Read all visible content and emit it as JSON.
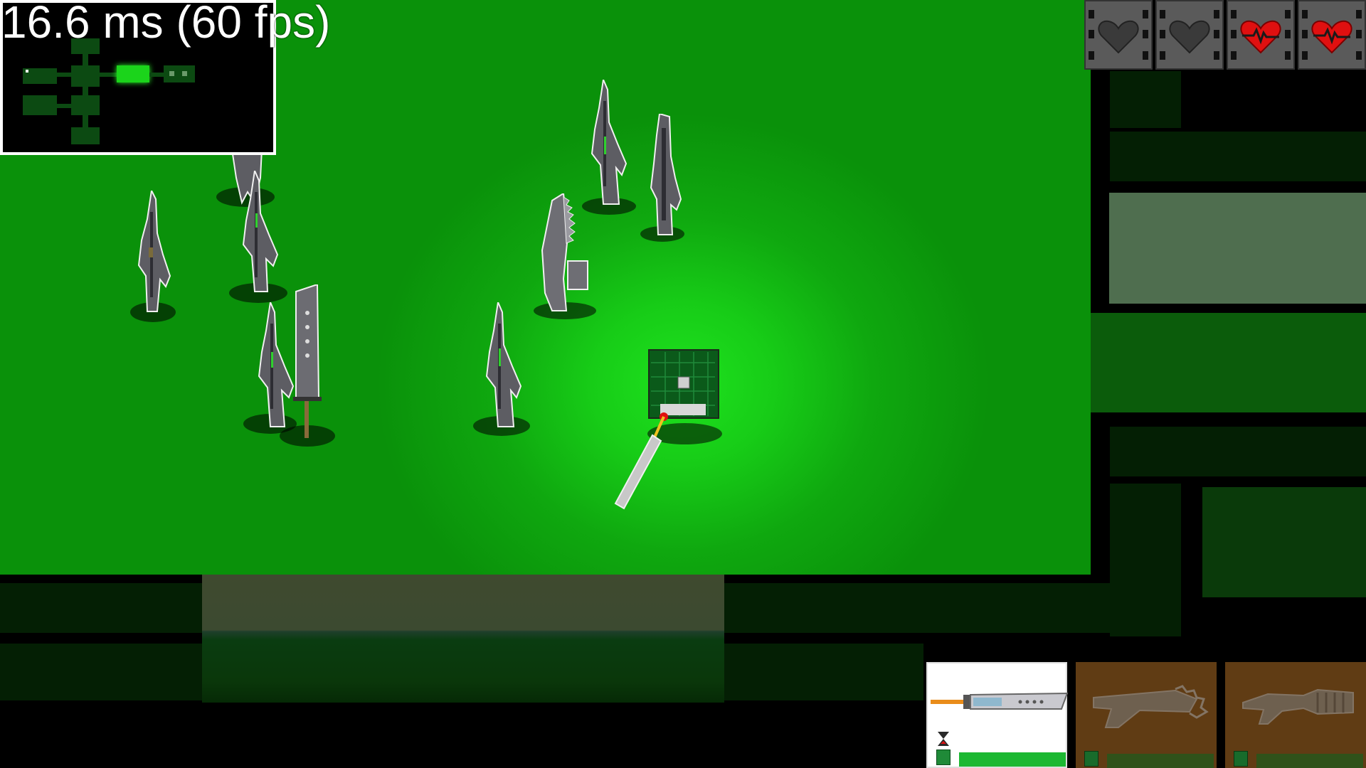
{
  "hud": {
    "frame_time": "16.6 ms (60 fps)"
  },
  "player": {
    "hearts": [
      {
        "state": "empty",
        "icon": "empty-heart-icon"
      },
      {
        "state": "empty",
        "icon": "empty-heart-icon"
      },
      {
        "state": "full",
        "icon": "heartbeat-heart-icon"
      },
      {
        "state": "full",
        "icon": "heartbeat-heart-icon"
      }
    ]
  },
  "weapons": {
    "slots": [
      {
        "name": "buster-sword",
        "selected": true,
        "cooldown_fill": 1.0
      },
      {
        "name": "lancer-chainsaw-rifle",
        "selected": false,
        "cooldown_fill": 1.0
      },
      {
        "name": "gatling-gun",
        "selected": false,
        "cooldown_fill": 1.0
      }
    ]
  },
  "colors": {
    "floor": "#17cc17",
    "hud_text": "#ffffff",
    "heart_red": "#e01010",
    "cooldown_bar": "#1cb832"
  }
}
